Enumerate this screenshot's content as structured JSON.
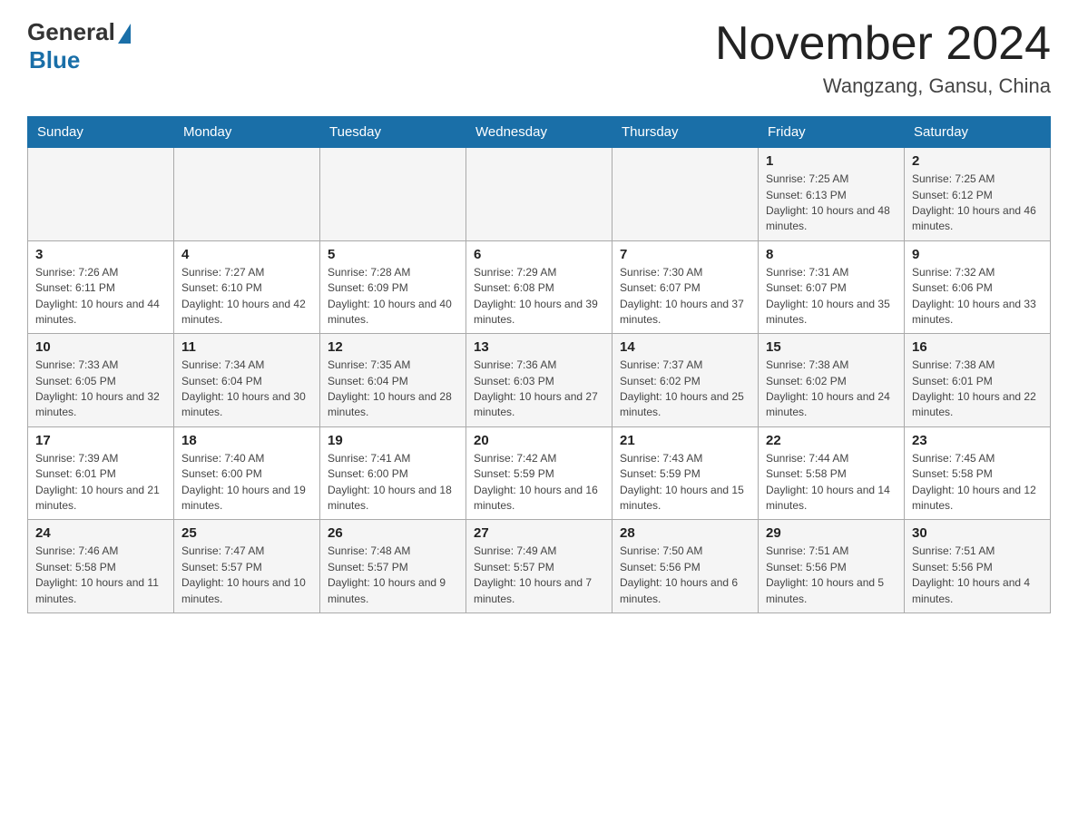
{
  "header": {
    "logo": {
      "general": "General",
      "blue": "Blue"
    },
    "title": "November 2024",
    "location": "Wangzang, Gansu, China"
  },
  "weekdays": [
    "Sunday",
    "Monday",
    "Tuesday",
    "Wednesday",
    "Thursday",
    "Friday",
    "Saturday"
  ],
  "weeks": [
    [
      {
        "day": "",
        "info": ""
      },
      {
        "day": "",
        "info": ""
      },
      {
        "day": "",
        "info": ""
      },
      {
        "day": "",
        "info": ""
      },
      {
        "day": "",
        "info": ""
      },
      {
        "day": "1",
        "info": "Sunrise: 7:25 AM\nSunset: 6:13 PM\nDaylight: 10 hours and 48 minutes."
      },
      {
        "day": "2",
        "info": "Sunrise: 7:25 AM\nSunset: 6:12 PM\nDaylight: 10 hours and 46 minutes."
      }
    ],
    [
      {
        "day": "3",
        "info": "Sunrise: 7:26 AM\nSunset: 6:11 PM\nDaylight: 10 hours and 44 minutes."
      },
      {
        "day": "4",
        "info": "Sunrise: 7:27 AM\nSunset: 6:10 PM\nDaylight: 10 hours and 42 minutes."
      },
      {
        "day": "5",
        "info": "Sunrise: 7:28 AM\nSunset: 6:09 PM\nDaylight: 10 hours and 40 minutes."
      },
      {
        "day": "6",
        "info": "Sunrise: 7:29 AM\nSunset: 6:08 PM\nDaylight: 10 hours and 39 minutes."
      },
      {
        "day": "7",
        "info": "Sunrise: 7:30 AM\nSunset: 6:07 PM\nDaylight: 10 hours and 37 minutes."
      },
      {
        "day": "8",
        "info": "Sunrise: 7:31 AM\nSunset: 6:07 PM\nDaylight: 10 hours and 35 minutes."
      },
      {
        "day": "9",
        "info": "Sunrise: 7:32 AM\nSunset: 6:06 PM\nDaylight: 10 hours and 33 minutes."
      }
    ],
    [
      {
        "day": "10",
        "info": "Sunrise: 7:33 AM\nSunset: 6:05 PM\nDaylight: 10 hours and 32 minutes."
      },
      {
        "day": "11",
        "info": "Sunrise: 7:34 AM\nSunset: 6:04 PM\nDaylight: 10 hours and 30 minutes."
      },
      {
        "day": "12",
        "info": "Sunrise: 7:35 AM\nSunset: 6:04 PM\nDaylight: 10 hours and 28 minutes."
      },
      {
        "day": "13",
        "info": "Sunrise: 7:36 AM\nSunset: 6:03 PM\nDaylight: 10 hours and 27 minutes."
      },
      {
        "day": "14",
        "info": "Sunrise: 7:37 AM\nSunset: 6:02 PM\nDaylight: 10 hours and 25 minutes."
      },
      {
        "day": "15",
        "info": "Sunrise: 7:38 AM\nSunset: 6:02 PM\nDaylight: 10 hours and 24 minutes."
      },
      {
        "day": "16",
        "info": "Sunrise: 7:38 AM\nSunset: 6:01 PM\nDaylight: 10 hours and 22 minutes."
      }
    ],
    [
      {
        "day": "17",
        "info": "Sunrise: 7:39 AM\nSunset: 6:01 PM\nDaylight: 10 hours and 21 minutes."
      },
      {
        "day": "18",
        "info": "Sunrise: 7:40 AM\nSunset: 6:00 PM\nDaylight: 10 hours and 19 minutes."
      },
      {
        "day": "19",
        "info": "Sunrise: 7:41 AM\nSunset: 6:00 PM\nDaylight: 10 hours and 18 minutes."
      },
      {
        "day": "20",
        "info": "Sunrise: 7:42 AM\nSunset: 5:59 PM\nDaylight: 10 hours and 16 minutes."
      },
      {
        "day": "21",
        "info": "Sunrise: 7:43 AM\nSunset: 5:59 PM\nDaylight: 10 hours and 15 minutes."
      },
      {
        "day": "22",
        "info": "Sunrise: 7:44 AM\nSunset: 5:58 PM\nDaylight: 10 hours and 14 minutes."
      },
      {
        "day": "23",
        "info": "Sunrise: 7:45 AM\nSunset: 5:58 PM\nDaylight: 10 hours and 12 minutes."
      }
    ],
    [
      {
        "day": "24",
        "info": "Sunrise: 7:46 AM\nSunset: 5:58 PM\nDaylight: 10 hours and 11 minutes."
      },
      {
        "day": "25",
        "info": "Sunrise: 7:47 AM\nSunset: 5:57 PM\nDaylight: 10 hours and 10 minutes."
      },
      {
        "day": "26",
        "info": "Sunrise: 7:48 AM\nSunset: 5:57 PM\nDaylight: 10 hours and 9 minutes."
      },
      {
        "day": "27",
        "info": "Sunrise: 7:49 AM\nSunset: 5:57 PM\nDaylight: 10 hours and 7 minutes."
      },
      {
        "day": "28",
        "info": "Sunrise: 7:50 AM\nSunset: 5:56 PM\nDaylight: 10 hours and 6 minutes."
      },
      {
        "day": "29",
        "info": "Sunrise: 7:51 AM\nSunset: 5:56 PM\nDaylight: 10 hours and 5 minutes."
      },
      {
        "day": "30",
        "info": "Sunrise: 7:51 AM\nSunset: 5:56 PM\nDaylight: 10 hours and 4 minutes."
      }
    ]
  ]
}
